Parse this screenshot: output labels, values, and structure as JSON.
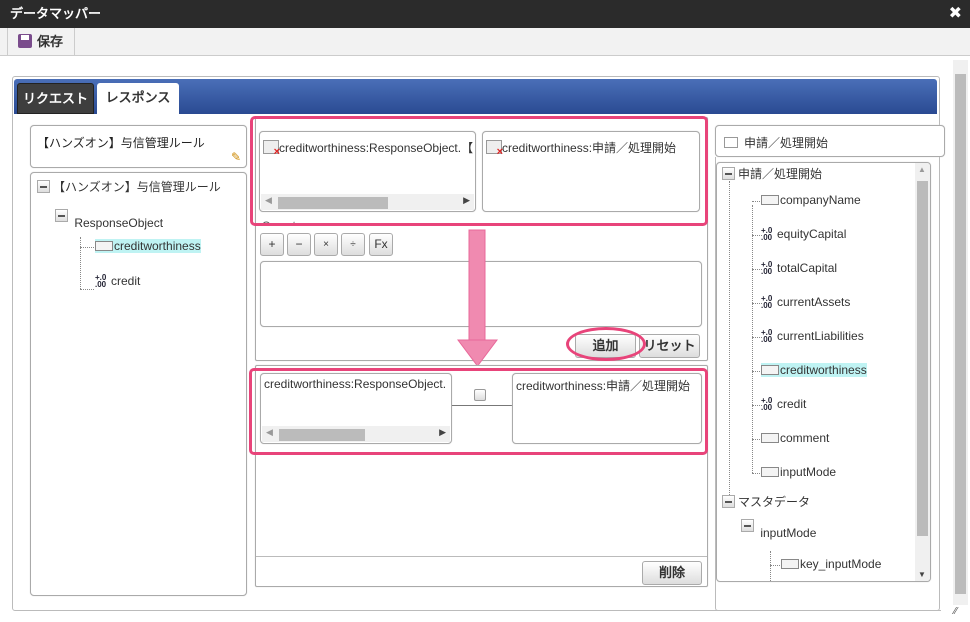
{
  "window": {
    "title": "データマッパー",
    "close_icon": "close-icon"
  },
  "toolbar": {
    "save_label": "保存"
  },
  "tabs": [
    {
      "label": "リクエスト",
      "active": false
    },
    {
      "label": "レスポンス",
      "active": true
    }
  ],
  "left": {
    "name": "【ハンズオン】与信管理ルール",
    "tree": {
      "root": "【ハンズオン】与信管理ルール",
      "object": "ResponseObject",
      "items": [
        {
          "label": "creditworthiness",
          "type": "string",
          "selected": true
        },
        {
          "label": "credit",
          "type": "number",
          "selected": false
        }
      ]
    }
  },
  "mapping_edit": {
    "source": "creditworthiness:ResponseObject.【ハ",
    "target": "creditworthiness:申請／処理開始",
    "operators_label": "Operators",
    "operators": [
      "+",
      "−",
      "×",
      "÷",
      "Fx"
    ],
    "expression": "",
    "add_label": "追加",
    "reset_label": "リセット"
  },
  "mappings": {
    "rows": [
      {
        "source": "creditworthiness:ResponseObject.",
        "target": "creditworthiness:申請／処理開始"
      }
    ],
    "delete_label": "削除"
  },
  "right": {
    "title": "申請／処理開始",
    "tree": {
      "root": "申請／処理開始",
      "items": [
        {
          "label": "companyName",
          "type": "string"
        },
        {
          "label": "equityCapital",
          "type": "number"
        },
        {
          "label": "totalCapital",
          "type": "number"
        },
        {
          "label": "currentAssets",
          "type": "number"
        },
        {
          "label": "currentLiabilities",
          "type": "number"
        },
        {
          "label": "creditworthiness",
          "type": "string",
          "selected": true
        },
        {
          "label": "credit",
          "type": "number"
        },
        {
          "label": "comment",
          "type": "string"
        },
        {
          "label": "inputMode",
          "type": "string"
        }
      ],
      "master": "マスタデータ",
      "master_child": "inputMode",
      "master_leaf": "key_inputMode"
    }
  },
  "colors": {
    "highlight": "#e8447a",
    "arrow": "#f08ab0",
    "tabbar": "#2a4a92",
    "selected": "#bff3f3"
  }
}
